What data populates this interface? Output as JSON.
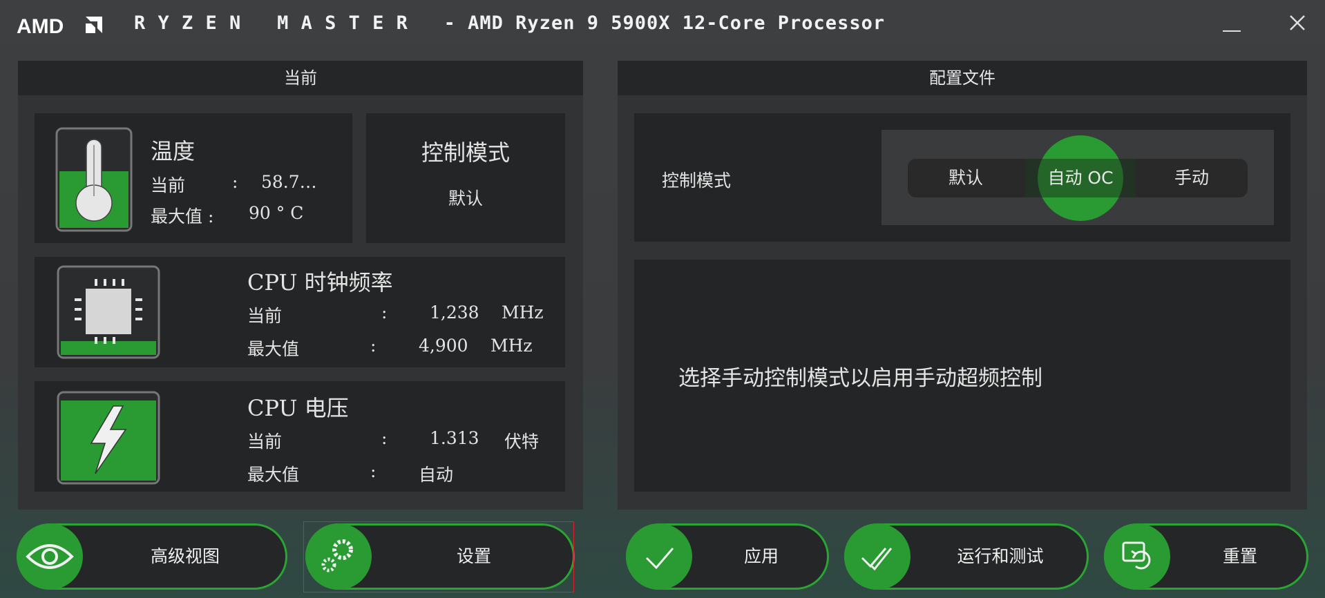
{
  "window": {
    "logo_text": "AMD",
    "title": "R Y Z E N   M A S T E R   - AMD Ryzen 9 5900X 12-Core Processor"
  },
  "current": {
    "header": "当前",
    "temperature": {
      "title": "温度",
      "current_label": "当前",
      "current_sep": ":",
      "current_value": "58.7…",
      "max_label": "最大值 :",
      "max_value": "90 ° C"
    },
    "control_mode": {
      "title": "控制模式",
      "value": "默认"
    },
    "clock": {
      "title": "CPU 时钟频率",
      "current_label": "当前",
      "current_sep": ":",
      "current_value": "1,238",
      "current_unit": "MHz",
      "max_label": "最大值",
      "max_sep": ":",
      "max_value": "4,900",
      "max_unit": "MHz"
    },
    "voltage": {
      "title": "CPU 电压",
      "current_label": "当前",
      "current_sep": ":",
      "current_value": "1.313",
      "current_unit": "伏特",
      "max_label": "最大值",
      "max_sep": ":",
      "max_value": "自动"
    }
  },
  "profile": {
    "header": "配置文件",
    "control_mode_label": "控制模式",
    "modes": [
      "默认",
      "自动 OC",
      "手动"
    ],
    "selected_mode": "自动 OC",
    "message": "选择手动控制模式以启用手动超频控制"
  },
  "buttons": {
    "advanced_view": "高级视图",
    "settings": "设置",
    "apply": "应用",
    "run_test": "运行和测试",
    "reset": "重置"
  },
  "colors": {
    "accent_green": "#2a9a32",
    "panel": "#313335",
    "card": "#242526",
    "highlight_border": "#e0202a"
  }
}
